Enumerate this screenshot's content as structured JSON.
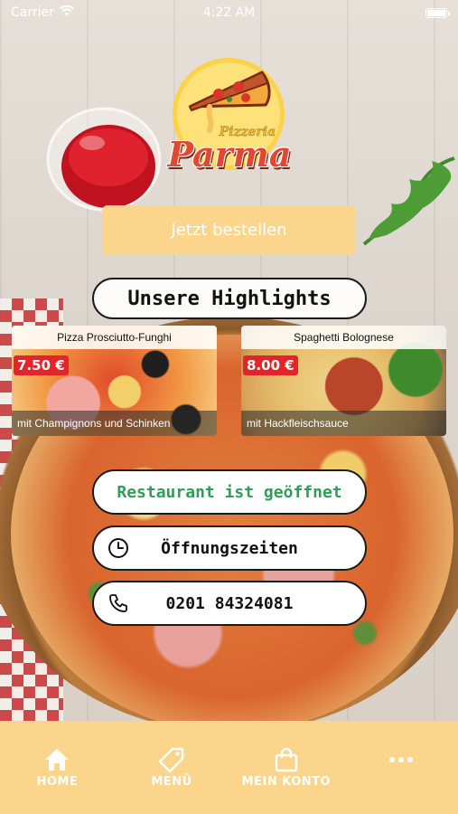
{
  "status_bar": {
    "carrier": "Carrier",
    "time": "4:22 AM"
  },
  "logo": {
    "subtitle": "Pizzeria",
    "title": "Parma"
  },
  "order_button": {
    "label": "Jetzt bestellen"
  },
  "highlights": {
    "title": "Unsere Highlights",
    "items": [
      {
        "name": "Pizza Prosciutto-Funghi",
        "price": "7.50 €",
        "description": "mit Champignons und Schinken"
      },
      {
        "name": "Spaghetti Bolognese",
        "price": "8.00 €",
        "description": "mit Hackfleischsauce"
      }
    ]
  },
  "info": {
    "status": "Restaurant ist geöffnet",
    "status_color": "#2f9e57",
    "hours_label": "Öffnungszeiten",
    "hours_icon": "clock-icon",
    "phone": "0201 84324081",
    "phone_icon": "phone-icon"
  },
  "bottom_nav": {
    "items": [
      {
        "label": "HOME",
        "icon": "home-icon"
      },
      {
        "label": "MENÜ",
        "icon": "tag-icon"
      },
      {
        "label": "MEIN KONTO",
        "icon": "shopping-bag-icon"
      },
      {
        "label": "",
        "icon": "more-dots-icon"
      }
    ]
  },
  "colors": {
    "accent": "#fbd58b",
    "price_badge": "#e3252a",
    "logo_red": "#e3472f"
  }
}
